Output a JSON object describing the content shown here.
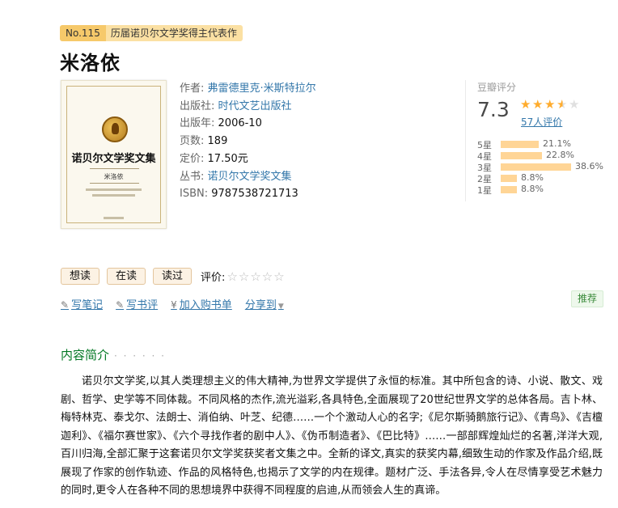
{
  "badge": {
    "number": "No.115",
    "text": "历届诺贝尔文学奖得主代表作"
  },
  "book": {
    "title": "米洛依",
    "cover": {
      "series_title": "诺贝尔文学奖文集",
      "book_name": "米洛依"
    },
    "info": [
      {
        "label": "作者:",
        "value": "弗雷德里克·米斯特拉尔",
        "link": true
      },
      {
        "label": "出版社:",
        "value": "时代文艺出版社",
        "link": true
      },
      {
        "label": "出版年:",
        "value": "2006-10",
        "link": false
      },
      {
        "label": "页数:",
        "value": "189",
        "link": false
      },
      {
        "label": "定价:",
        "value": "17.50元",
        "link": false
      },
      {
        "label": "丛书:",
        "value": "诺贝尔文学奖文集",
        "link": true
      },
      {
        "label": "ISBN:",
        "value": "9787538721713",
        "link": false
      }
    ]
  },
  "rating": {
    "heading": "豆瓣评分",
    "score": "7.3",
    "stars": 3.5,
    "count": "57人评价",
    "distribution": [
      {
        "label": "5星",
        "percent": 21.1,
        "text": "21.1%"
      },
      {
        "label": "4星",
        "percent": 22.8,
        "text": "22.8%"
      },
      {
        "label": "3星",
        "percent": 38.6,
        "text": "38.6%"
      },
      {
        "label": "2星",
        "percent": 8.8,
        "text": "8.8%"
      },
      {
        "label": "1星",
        "percent": 8.8,
        "text": "8.8%"
      }
    ]
  },
  "buttons": {
    "want": "想读",
    "reading": "在读",
    "read": "读过",
    "my_rating_label": "评价:"
  },
  "actions": {
    "write_note": "写笔记",
    "write_review": "写书评",
    "cart_icon": "¥",
    "add_cart": "加入购书单",
    "share": "分享到",
    "recommend": "推荐"
  },
  "intro": {
    "heading": "内容简介",
    "dots": "· · · · · ·",
    "text": "诺贝尔文学奖,以其人类理想主义的伟大精神,为世界文学提供了永恒的标准。其中所包含的诗、小说、散文、戏剧、哲学、史学等不同体裁。不同风格的杰作,流光溢彩,各具特色,全面展现了20世纪世界文学的总体各局。吉卜林、梅特林克、泰戈尔、法朗士、消伯纳、叶芝、纪德……一个个激动人心的名字;《尼尔斯骑鹅旅行记》、《青鸟》、《吉檀迦利》、《福尔赛世家》、《六个寻找作者的剧中人》、《伪币制造者》、《巴比特》……一部部辉煌灿烂的名著,洋洋大观,百川归海,全部汇聚于这套诺贝尔文学奖获奖者文集之中。全新的译文,真实的获奖内幕,细致生动的作家及作品介绍,既展现了作家的创作轨迹、作品的风格特色,也揭示了文学的内在规律。题材广泛、手法各异,令人在尽情享受艺术魅力的同时,更令人在各种不同的思想境界中获得不同程度的启迪,从而领会人生的真谛。"
  },
  "colors": {
    "link": "#3377aa",
    "star": "#ffac2d",
    "bar": "#ffd596",
    "section": "#007722"
  }
}
